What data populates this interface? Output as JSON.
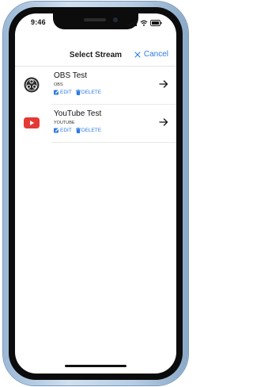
{
  "status_bar": {
    "time": "9:46"
  },
  "nav": {
    "title": "Select Stream",
    "cancel_label": "Cancel"
  },
  "streams": [
    {
      "name": "OBS Test",
      "type": "OBS",
      "edit_label": "EDIT",
      "delete_label": "DELETE",
      "icon": "obs-logo-icon"
    },
    {
      "name": "YouTube Test",
      "type": "YOUTUBE",
      "edit_label": "EDIT",
      "delete_label": "DELETE",
      "icon": "youtube-logo-icon"
    }
  ],
  "colors": {
    "accent": "#2d7be4",
    "youtube_red": "#e53935",
    "obs_dark": "#2a2a2a",
    "frame": "#b6cde4"
  }
}
